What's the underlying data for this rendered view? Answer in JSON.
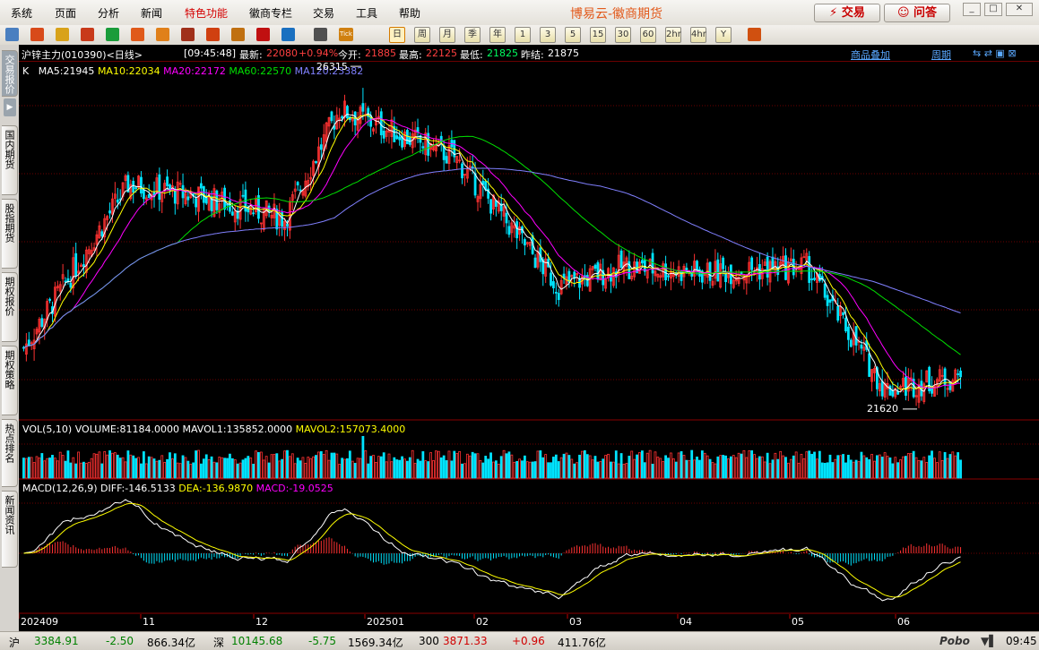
{
  "app": {
    "title": "博易云-徽商期货",
    "trade_button": "⚡ 交易",
    "ask_button": "☺ 问答"
  },
  "menu": [
    "系统",
    "页面",
    "分析",
    "新闻",
    "特色功能",
    "徽商专栏",
    "交易",
    "工具",
    "帮助"
  ],
  "toolbar": {
    "icons": [
      "back-icon",
      "home-icon",
      "book-icon",
      "briefcase-icon",
      "refresh-icon",
      "zoom-in-icon",
      "zoom-out-icon",
      "window-icon",
      "pencil-icon",
      "palette-icon",
      "filter-icon",
      "new-icon",
      "list-icon",
      "tick-icon"
    ],
    "tick_label": "Tick",
    "periods": [
      "日",
      "周",
      "月",
      "季",
      "年",
      "1",
      "3",
      "5",
      "15",
      "30",
      "60",
      "2hr",
      "4hr",
      "Y"
    ],
    "active_period": "日"
  },
  "nav_tabs": [
    "交易报价",
    "国内期货",
    "股指期货",
    "期权报价",
    "期权策略",
    "热点排名",
    "新闻资讯"
  ],
  "header": {
    "instrument": "沪锌主力(010390)<日线>",
    "time": "[09:45:48]",
    "latest_label": "最新:",
    "latest": "22080",
    "change": "+0.94%",
    "open_label": "今开:",
    "open": "21885",
    "high_label": "最高:",
    "high": "22125",
    "low_label": "最低:",
    "low": "21825",
    "prev_label": "昨结:",
    "prev": "21875",
    "overlay_link": "商品叠加",
    "period_link": "周期"
  },
  "ma_line": {
    "k": "K",
    "ma5": "MA5:21945",
    "ma10": "MA10:22034",
    "ma20": "MA20:22172",
    "ma60": "MA60:22570",
    "ma120": "MA120:23382"
  },
  "vol_line": {
    "vol": "VOL(5,10)",
    "volume": "VOLUME:81184.0000",
    "mavol1": "MAVOL1:135852.0000",
    "mavol2": "MAVOL2:157073.4000"
  },
  "macd_line": {
    "macd": "MACD(12,26,9)",
    "diff": "DIFF:-146.5133",
    "dea": "DEA:-136.9870",
    "macdv": "MACD:-19.0525"
  },
  "annotations": {
    "high": "26315",
    "low": "21620"
  },
  "x_labels": [
    "202409",
    "11",
    "12",
    "202501",
    "02",
    "03",
    "04",
    "05",
    "06"
  ],
  "colors": {
    "up": "#ff3232",
    "down": "#00e4ff",
    "ma5": "#ffffff",
    "ma10": "#ffff00",
    "ma20": "#ff00ff",
    "ma60": "#00e000",
    "ma120": "#8080ff",
    "grid": "#6b0000"
  },
  "chart_data": {
    "type": "candlestick",
    "anchors": {
      "x_days": [
        0,
        40,
        70,
        100,
        121,
        165,
        205,
        230,
        260,
        300,
        330,
        359
      ],
      "close": [
        22500,
        24900,
        24700,
        24400,
        26000,
        25300,
        23400,
        23700,
        23600,
        23700,
        21900,
        22080
      ]
    },
    "high": 26315,
    "low": 21620,
    "latest_price": 22080
  },
  "status": {
    "sh_label": "沪",
    "sh_index": "3384.91",
    "sh_change": "-2.50",
    "sh_amount": "866.34亿",
    "sz_label": "深",
    "sz_index": "10145.68",
    "sz_change": "-5.75",
    "sz_amount": "1569.34亿",
    "c300_label": "300",
    "c300_index": "3871.33",
    "c300_change": "+0.96",
    "c300_amount": "411.76亿",
    "brand": "Pobo",
    "clock": "09:45"
  }
}
